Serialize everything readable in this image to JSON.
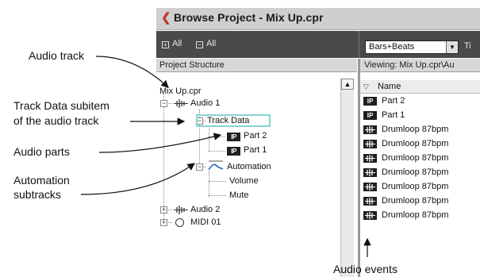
{
  "window": {
    "title": "Browse Project - Mix Up.cpr",
    "title_icon": "cubase-logo-icon"
  },
  "toolbar": {
    "expand_all": "All",
    "collapse_all": "All",
    "time_format": "Bars+Beats",
    "cut_text": "Ti"
  },
  "left_pane": {
    "header": "Project Structure",
    "tree": {
      "root": "Mix Up.cpr",
      "audio1": "Audio 1",
      "track_data": "Track Data",
      "part2": "Part 2",
      "part1": "Part 1",
      "automation": "Automation",
      "volume": "Volume",
      "mute": "Mute",
      "audio2": "Audio 2",
      "midi": "MIDI 01"
    }
  },
  "right_pane": {
    "viewing": "Viewing: Mix Up.cpr\\Au",
    "column_name": "Name",
    "rows": [
      {
        "label": "Part 2",
        "icon": "IP"
      },
      {
        "label": "Part 1",
        "icon": "IP"
      },
      {
        "label": "Drumloop 87bpm",
        "icon": "W"
      },
      {
        "label": "Drumloop 87bpm",
        "icon": "W"
      },
      {
        "label": "Drumloop 87bpm",
        "icon": "W"
      },
      {
        "label": "Drumloop 87bpm",
        "icon": "W"
      },
      {
        "label": "Drumloop 87bpm",
        "icon": "W"
      },
      {
        "label": "Drumloop 87bpm",
        "icon": "W"
      },
      {
        "label": "Drumloop 87bpm",
        "icon": "W"
      }
    ]
  },
  "callouts": {
    "audio_track": "Audio track",
    "track_data_line1": "Track Data subitem",
    "track_data_line2": "of the audio track",
    "audio_parts": "Audio parts",
    "automation_line1": "Automation",
    "automation_line2": "subtracks",
    "audio_events": "Audio events"
  }
}
